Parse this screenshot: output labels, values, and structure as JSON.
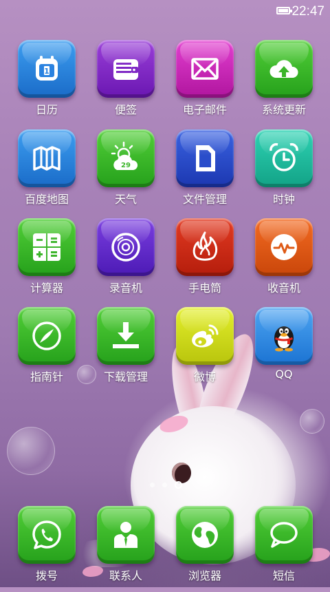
{
  "status_bar": {
    "time": "22:47"
  },
  "apps": [
    {
      "label": "日历",
      "icon": "calendar-icon",
      "color": "#2a82e0"
    },
    {
      "label": "便签",
      "icon": "notes-icon",
      "color": "#7f28c5"
    },
    {
      "label": "电子邮件",
      "icon": "mail-icon",
      "color": "#c82bb8"
    },
    {
      "label": "系统更新",
      "icon": "cloud-upload-icon",
      "color": "#3bb52a"
    },
    {
      "label": "百度地图",
      "icon": "map-icon",
      "color": "#2a82e0"
    },
    {
      "label": "天气",
      "icon": "weather-icon",
      "color": "#3bb52a",
      "badge": "29"
    },
    {
      "label": "文件管理",
      "icon": "file-icon",
      "color": "#2a4dca"
    },
    {
      "label": "时钟",
      "icon": "alarm-clock-icon",
      "color": "#1fbb9d"
    },
    {
      "label": "计算器",
      "icon": "calculator-icon",
      "color": "#3bb52a"
    },
    {
      "label": "录音机",
      "icon": "recorder-icon",
      "color": "#632cca"
    },
    {
      "label": "手电筒",
      "icon": "flame-icon",
      "color": "#cc2c17"
    },
    {
      "label": "收音机",
      "icon": "radio-icon",
      "color": "#de5a16"
    },
    {
      "label": "指南针",
      "icon": "compass-icon",
      "color": "#3bb52a"
    },
    {
      "label": "下载管理",
      "icon": "download-icon",
      "color": "#3bb52a"
    },
    {
      "label": "微博",
      "icon": "weibo-icon",
      "color": "#cfd81c"
    },
    {
      "label": "QQ",
      "icon": "qq-penguin-icon",
      "color": "#2a8ae2"
    }
  ],
  "page_indicator": {
    "pages": 3,
    "current": 3
  },
  "dock": [
    {
      "label": "拨号",
      "icon": "phone-icon",
      "color": "#3bb52a"
    },
    {
      "label": "联系人",
      "icon": "contact-icon",
      "color": "#3bb52a"
    },
    {
      "label": "浏览器",
      "icon": "globe-icon",
      "color": "#3bb52a"
    },
    {
      "label": "短信",
      "icon": "message-icon",
      "color": "#3bb52a"
    }
  ]
}
